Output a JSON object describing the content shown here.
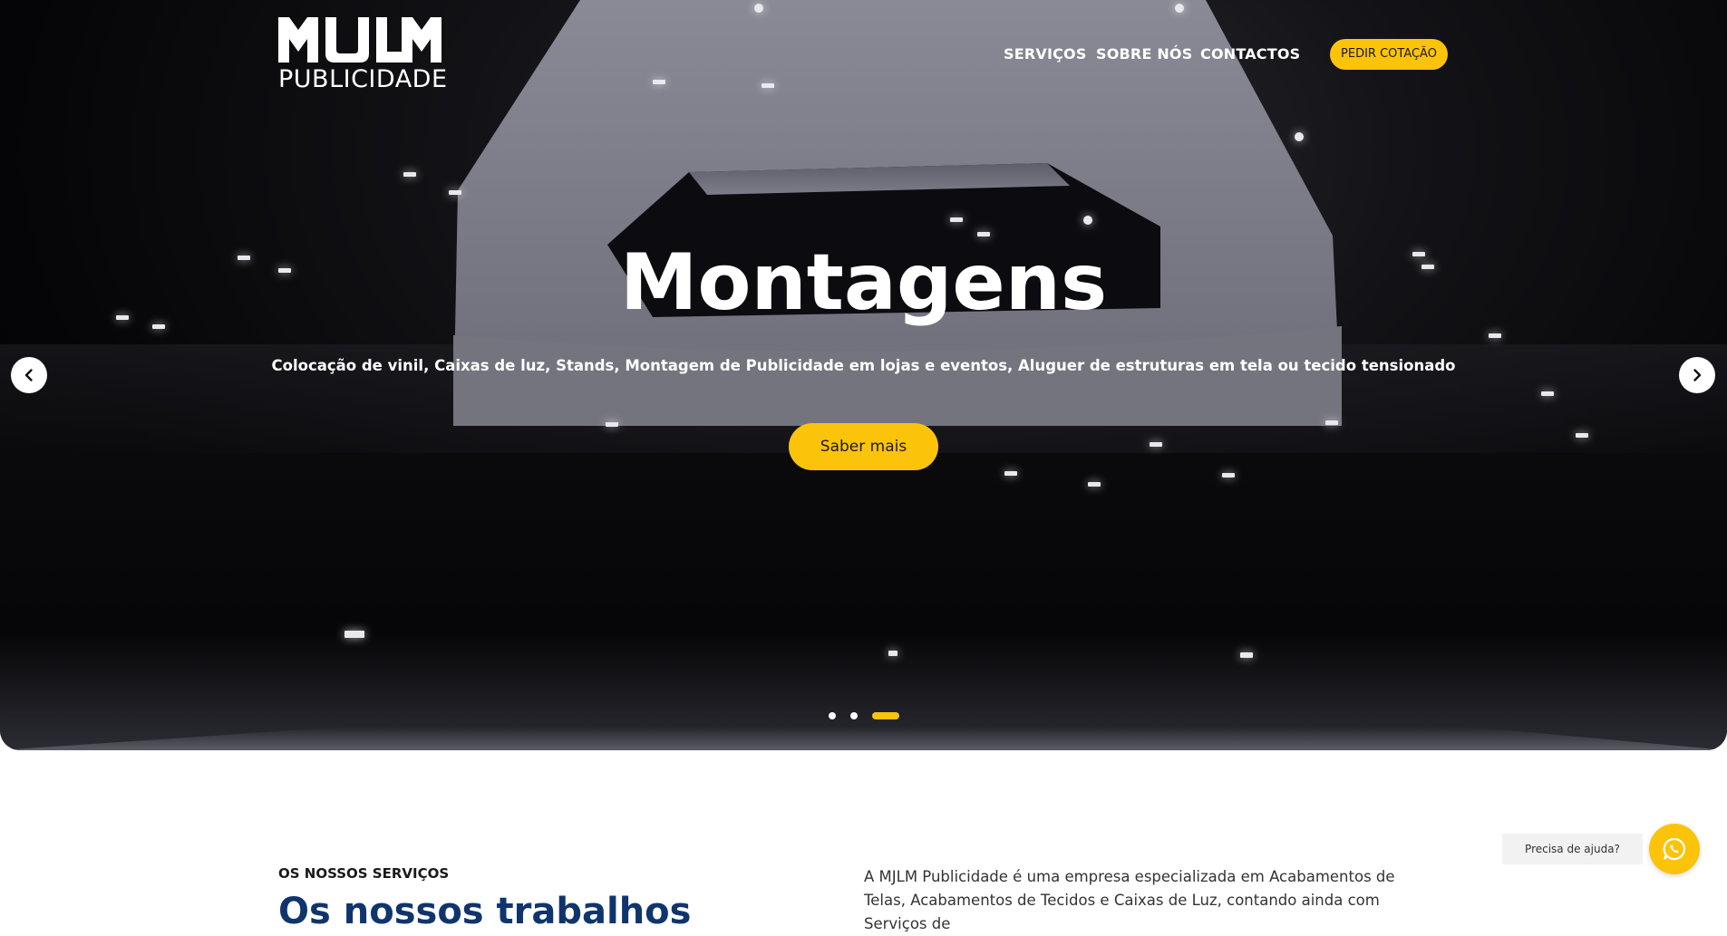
{
  "brand": {
    "logo_mark": "MJLM",
    "logo_text": "PUBLICIDADE",
    "accent_color": "#fcc30b",
    "heading_color": "#10356d"
  },
  "nav": {
    "items": [
      {
        "label": "SERVIÇOS"
      },
      {
        "label": "SOBRE NÓS"
      },
      {
        "label": "CONTACTOS"
      }
    ],
    "cta_label": "PEDIR COTAÇÃO"
  },
  "hero": {
    "title": "Montagens",
    "subtitle": "Colocação de vinil, Caixas de luz, Stands, Montagem de Publicidade em lojas e eventos, Aluguer de estruturas em tela ou tecido tensionado",
    "button_label": "Saber mais",
    "prev_icon": "chevron-left-icon",
    "next_icon": "chevron-right-icon",
    "slides_total": 3,
    "active_slide": 3
  },
  "services": {
    "label": "OS NOSSOS SERVIÇOS",
    "heading": "Os nossos trabalhos",
    "text": "A MJLM Publicidade é uma empresa especializada em Acabamentos de Telas, Acabamentos de Tecidos e Caixas de Luz, contando ainda com Serviços de"
  },
  "help": {
    "label": "Precisa de ajuda?",
    "icon": "whatsapp-icon"
  }
}
